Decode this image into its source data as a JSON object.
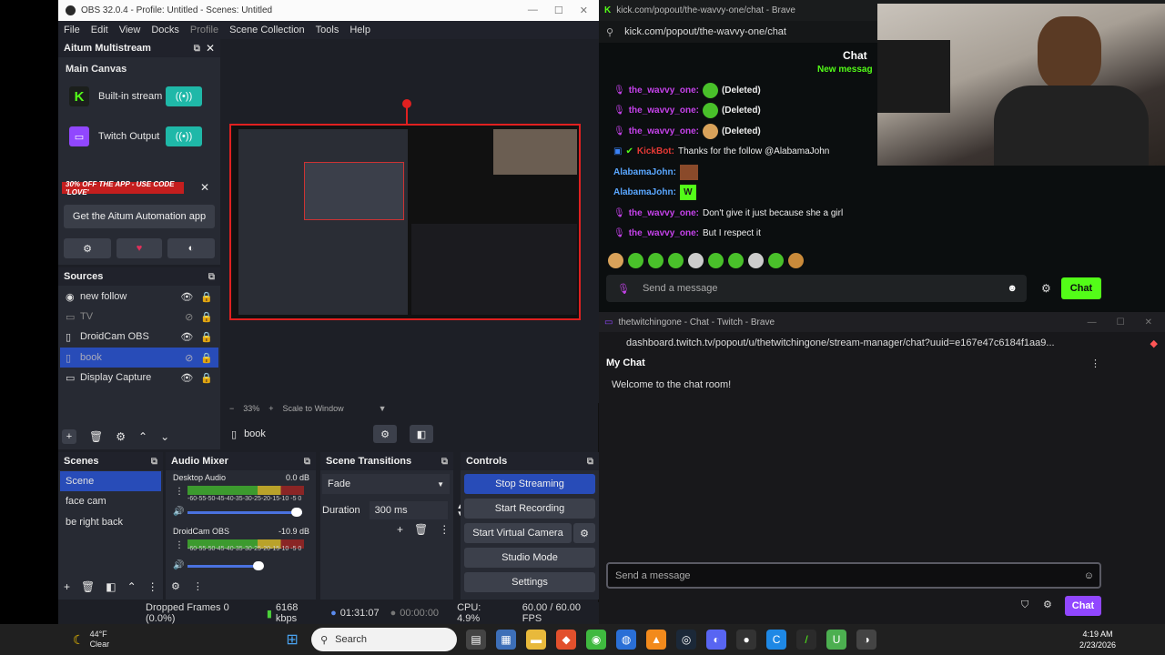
{
  "obs": {
    "title": "OBS 32.0.4 - Profile: Untitled - Scenes: Untitled",
    "menu": [
      "File",
      "Edit",
      "View",
      "Docks",
      "Profile",
      "Scene Collection",
      "Tools",
      "Help"
    ],
    "aitum": {
      "title": "Aitum Multistream",
      "canvas_label": "Main Canvas",
      "outputs": [
        "Built-in stream",
        "Twitch Output"
      ],
      "promo": "30% OFF THE APP - USE CODE 'LOVE'",
      "app_button": "Get the Aitum Automation app"
    },
    "sources": {
      "title": "Sources",
      "items": [
        "new follow",
        "TV",
        "DroidCam OBS",
        "book",
        "Display Capture"
      ]
    },
    "preview": {
      "zoom": "33%",
      "scale_mode": "Scale to Window"
    },
    "source_bar_label": "book",
    "scenes": {
      "title": "Scenes",
      "items": [
        "Scene",
        "face cam",
        "be right back"
      ]
    },
    "mixer": {
      "title": "Audio Mixer",
      "channels": [
        {
          "name": "Desktop Audio",
          "db": "0.0 dB",
          "scale": "-60-55-50-45-40-35-30-25-20-15-10 -5 0"
        },
        {
          "name": "DroidCam OBS",
          "db": "-10.9 dB",
          "scale": "-60-55-50-45-40-35-30-25-20-15-10 -5 0"
        }
      ]
    },
    "transitions": {
      "title": "Scene Transitions",
      "type": "Fade",
      "duration_label": "Duration",
      "duration_value": "300 ms"
    },
    "controls": {
      "title": "Controls",
      "buttons": [
        "Stop Streaming",
        "Start Recording",
        "Start Virtual Camera",
        "Studio Mode",
        "Settings"
      ]
    },
    "status": {
      "dropped": "Dropped Frames 0 (0.0%)",
      "kbps": "6168 kbps",
      "stream_time": "01:31:07",
      "rec_time": "00:00:00",
      "cpu": "CPU: 4.9%",
      "fps": "60.00 / 60.00 FPS"
    }
  },
  "kick": {
    "window_title": "kick.com/popout/the-wavvy-one/chat - Brave",
    "url": "kick.com/popout/the-wavvy-one/chat",
    "header": "Chat",
    "new_messages": "New messag",
    "messages": [
      {
        "user": "the_wavvy_one:",
        "text": "(Deleted)"
      },
      {
        "user": "the_wavvy_one:",
        "text": "(Deleted)"
      },
      {
        "user": "the_wavvy_one:",
        "text": "(Deleted)"
      },
      {
        "user": "KickBot:",
        "text": "Thanks for the follow @AlabamaJohn"
      },
      {
        "user": "AlabamaJohn:",
        "text": ""
      },
      {
        "user": "AlabamaJohn:",
        "text": ""
      },
      {
        "user": "the_wavvy_one:",
        "text": "Don't give it just because she a girl"
      },
      {
        "user": "the_wavvy_one:",
        "text": "But I respect it"
      }
    ],
    "input_placeholder": "Send a message",
    "chat_button": "Chat"
  },
  "twitch": {
    "window_title": "thetwitchingone - Chat - Twitch - Brave",
    "url": "dashboard.twitch.tv/popout/u/thetwitchingone/stream-manager/chat?uuid=e167e47c6184f1aa9...",
    "header": "My Chat",
    "welcome": "Welcome to the chat room!",
    "input_placeholder": "Send a message",
    "chat_button": "Chat"
  },
  "taskbar": {
    "temp": "44°F",
    "weather": "Clear",
    "search": "Search",
    "time": "4:19 AM",
    "date": "2/23/2026"
  },
  "colors": {
    "obs_blue": "#284cb8",
    "kick_green": "#53fc18",
    "twitch_purple": "#9147ff",
    "selection_red": "#e02020"
  }
}
